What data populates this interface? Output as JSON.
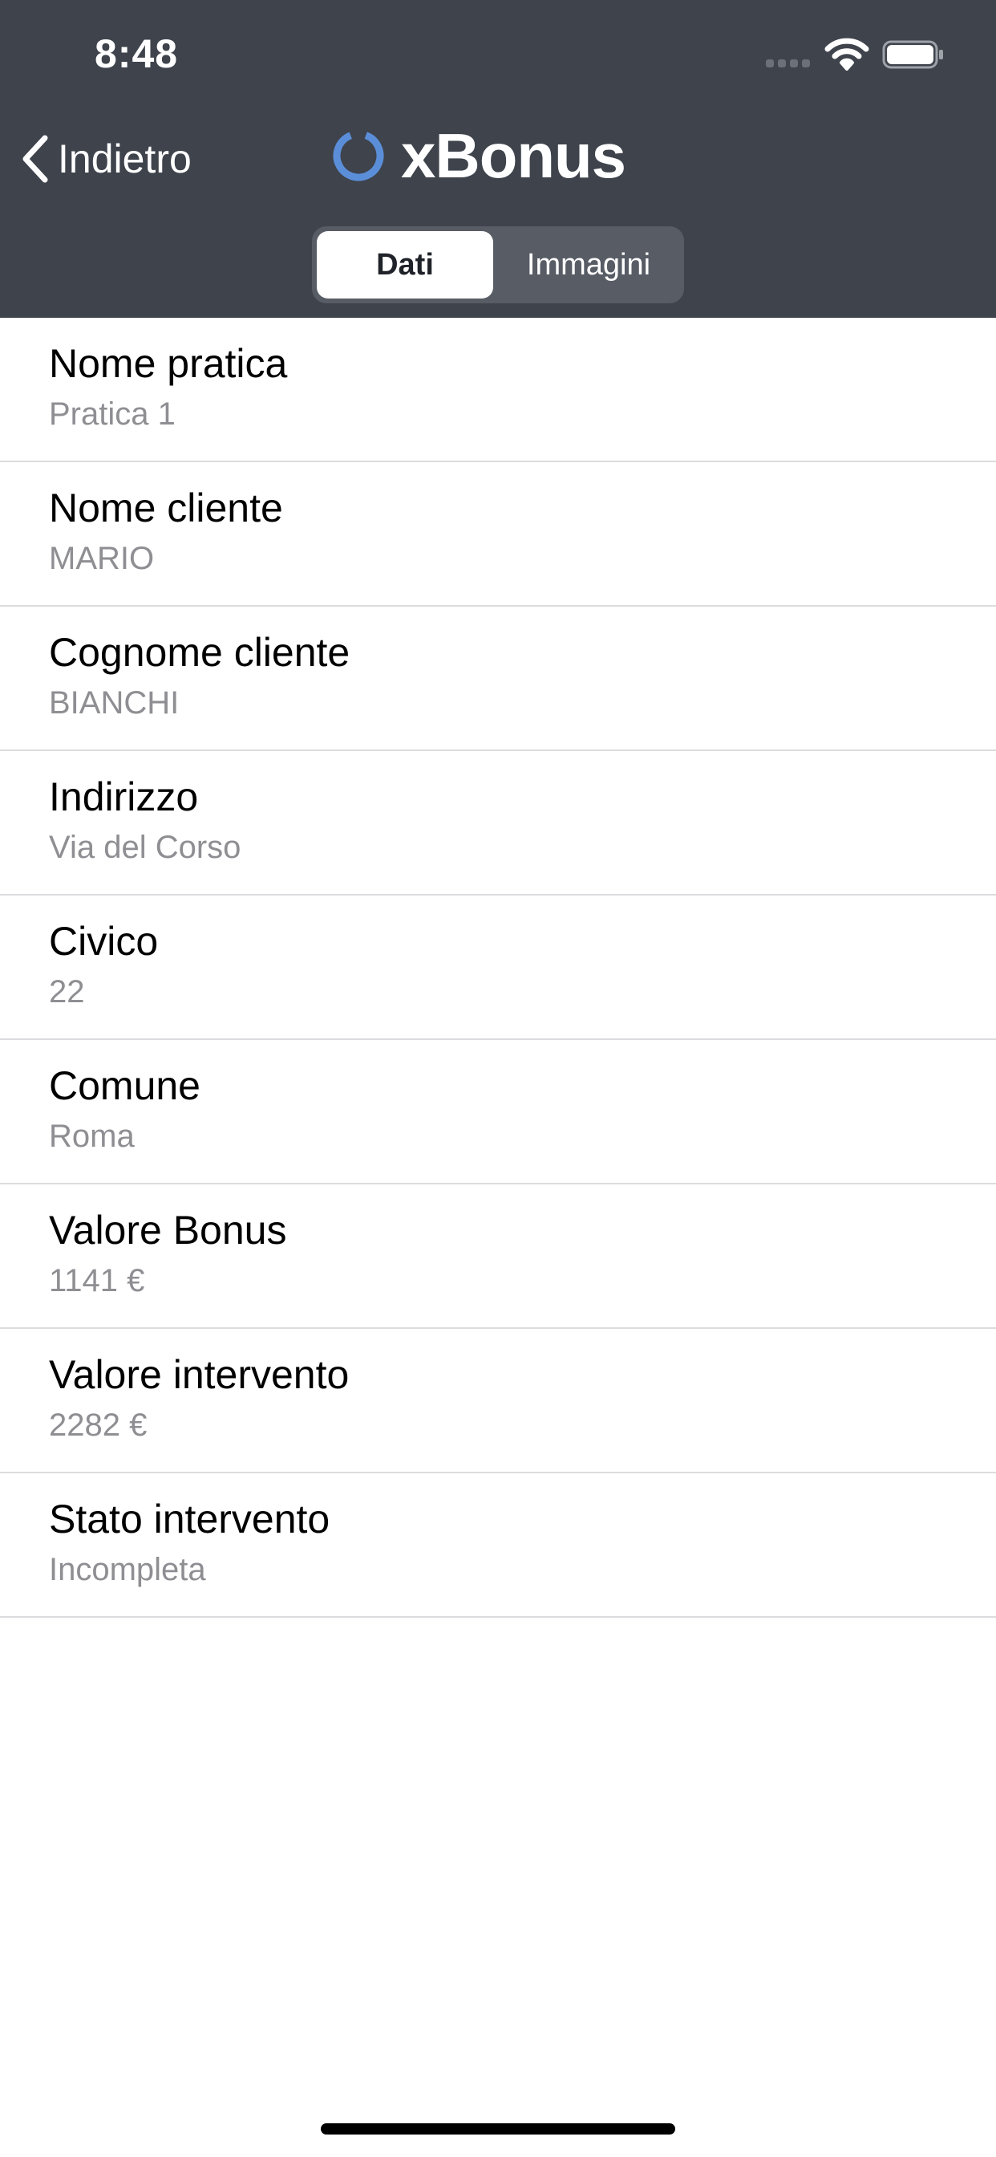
{
  "status_bar": {
    "time": "8:48"
  },
  "nav": {
    "back_label": "Indietro",
    "logo_text": "xBonus",
    "logo_color": "#5b8ed8",
    "header_color": "#3e434c"
  },
  "segmented": {
    "active": "Dati",
    "inactive": "Immagini"
  },
  "rows": [
    {
      "label": "Nome pratica",
      "value": "Pratica 1"
    },
    {
      "label": "Nome cliente",
      "value": "MARIO"
    },
    {
      "label": "Cognome cliente",
      "value": "BIANCHI"
    },
    {
      "label": "Indirizzo",
      "value": "Via del Corso"
    },
    {
      "label": "Civico",
      "value": "22"
    },
    {
      "label": "Comune",
      "value": "Roma"
    },
    {
      "label": "Valore Bonus",
      "value": "1141 €"
    },
    {
      "label": "Valore intervento",
      "value": "2282 €"
    },
    {
      "label": "Stato intervento",
      "value": "Incompleta"
    }
  ]
}
